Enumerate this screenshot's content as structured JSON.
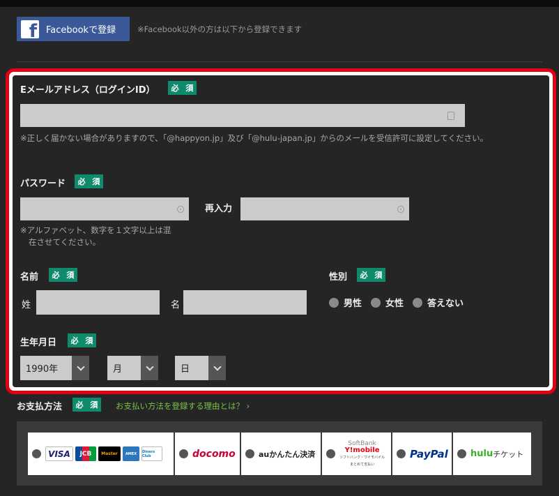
{
  "facebook": {
    "button_label": "Facebookで登録",
    "icon_letter": "f",
    "note": "※Facebook以外の方は以下から登録できます"
  },
  "required_badge": "必 須",
  "email": {
    "label": "Eメールアドレス（ログインID）",
    "value": "",
    "note": "※正しく届かない場合がありますので、「@happyon.jp」及び「@hulu-japan.jp」からのメールを受信許可に設定してください。"
  },
  "password": {
    "label": "パスワード",
    "value": "",
    "confirm_label": "再入力",
    "confirm_value": "",
    "note_line1": "※アルファベット、数字を１文字以上は混",
    "note_line2": "在させてください。"
  },
  "name": {
    "label": "名前",
    "last_label": "姓",
    "last_value": "",
    "first_label": "名",
    "first_value": ""
  },
  "gender": {
    "label": "性別",
    "options": [
      "男性",
      "女性",
      "答えない"
    ]
  },
  "birthdate": {
    "label": "生年月日",
    "year": "1990年",
    "month": "月",
    "day": "日"
  },
  "payment": {
    "label": "お支払方法",
    "link": "お支払い方法を登録する理由とは？ ›",
    "cards": [
      "VISA",
      "JCB",
      "Master",
      "AMEX",
      "Diners Club"
    ],
    "docomo": "docomo",
    "au": "auかんたん決済",
    "softbank_top": "SoftBank",
    "softbank_mid": "Y!mobile",
    "softbank_bottom": "ソフトバンク・ワイモバイル",
    "softbank_bottom2": "まとめて支払い",
    "paypal": "PayPal",
    "hulu": "hulu",
    "hulu_suffix": "チケット"
  },
  "colors": {
    "required": "#0f8a6c",
    "highlight_border": "#e30012",
    "facebook": "#3b5998",
    "link": "#7dc048"
  }
}
